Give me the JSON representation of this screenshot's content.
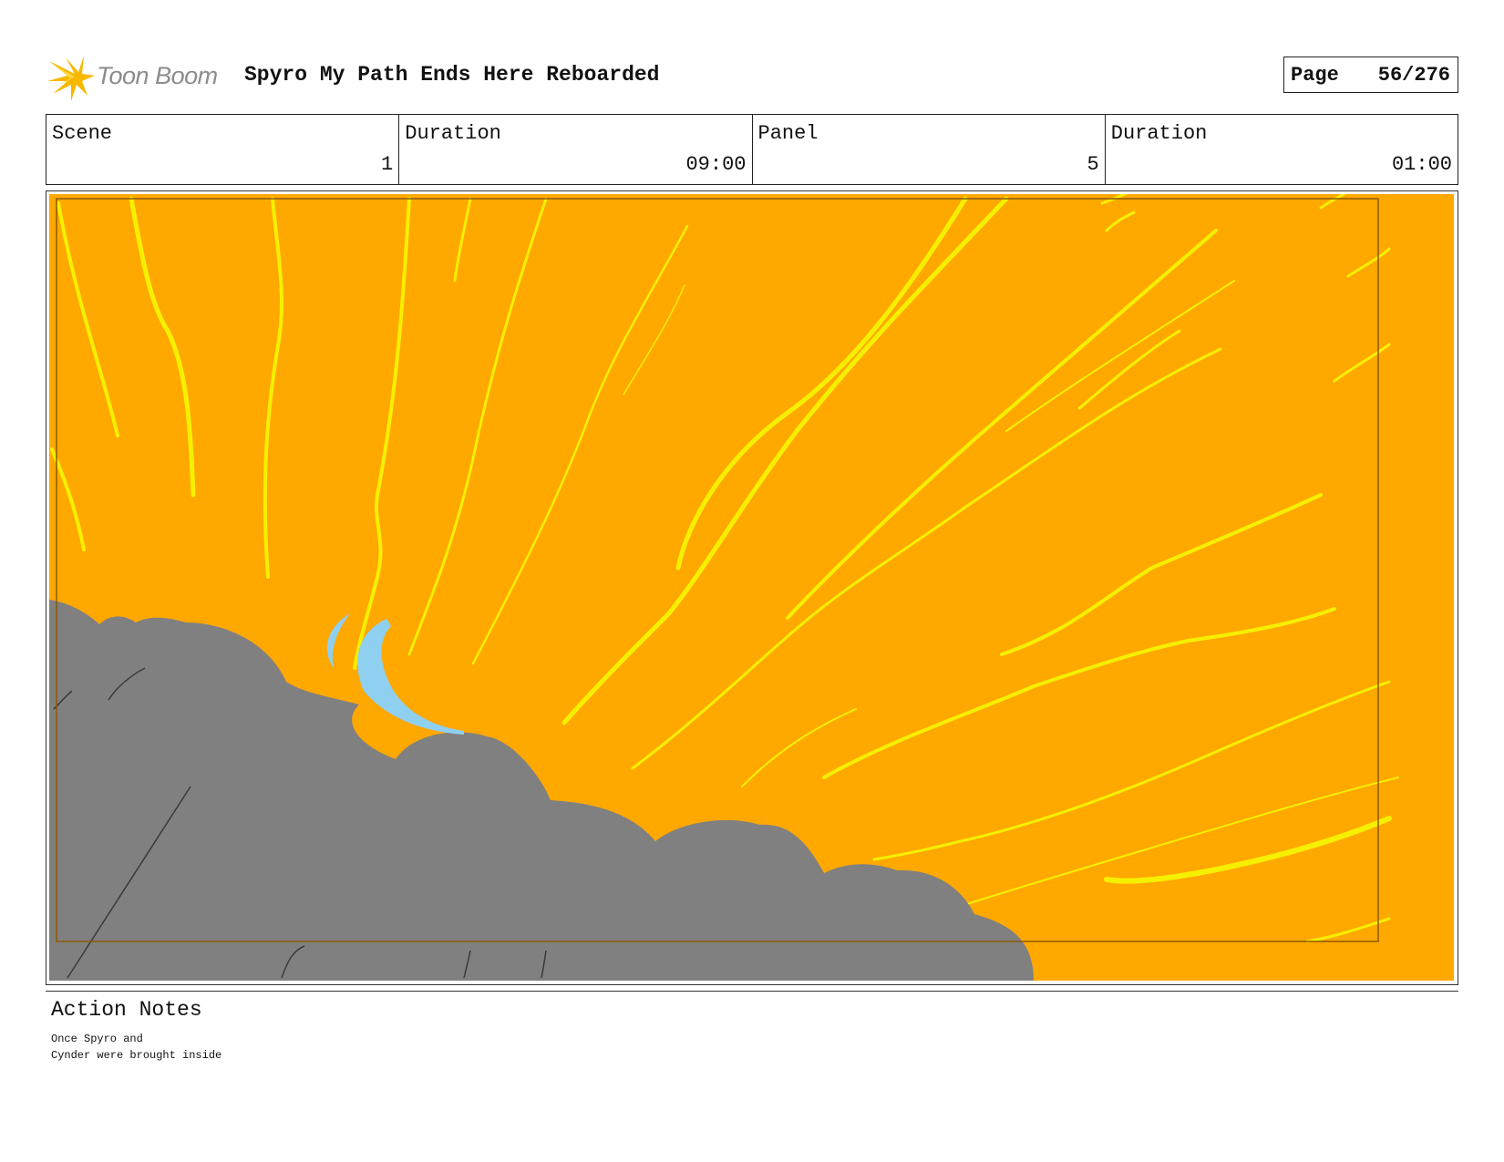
{
  "header": {
    "logo_text": "Toon Boom",
    "title": "Spyro My Path Ends Here Reboarded",
    "page_label": "Page",
    "page_value": "56/276"
  },
  "info": {
    "scene_label": "Scene",
    "scene_value": "1",
    "scene_duration_label": "Duration",
    "scene_duration_value": "09:00",
    "panel_label": "Panel",
    "panel_value": "5",
    "panel_duration_label": "Duration",
    "panel_duration_value": "01:00"
  },
  "panel": {
    "background_color": "#ffa800",
    "streak_color": "#f5f000",
    "cloud_color": "#808080",
    "wing_color": "#8fd0f0"
  },
  "notes": {
    "label": "Action Notes",
    "lines": [
      "Once Spyro and",
      "Cynder were brought inside"
    ]
  }
}
